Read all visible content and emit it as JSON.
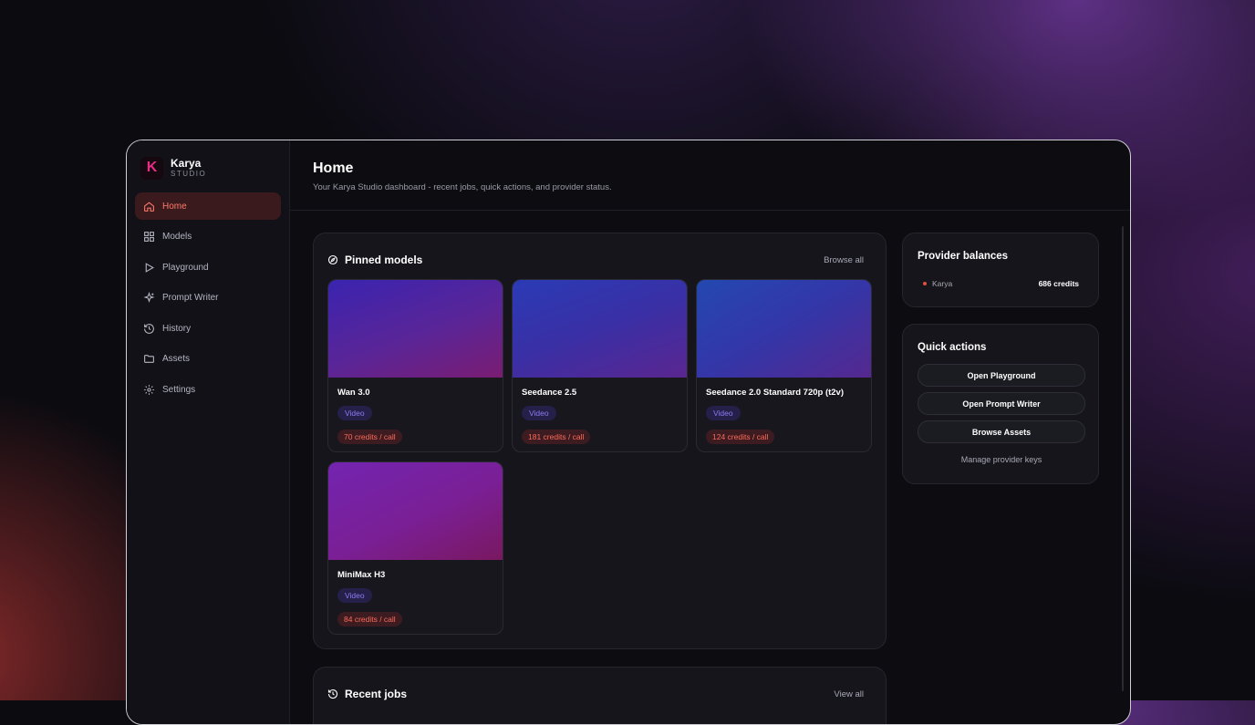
{
  "brand": {
    "name": "Karya",
    "sub": "STUDIO",
    "logo_letter": "K",
    "accent": "#ea2d86"
  },
  "nav": [
    {
      "label": "Home",
      "icon": "home-icon",
      "active": true
    },
    {
      "label": "Models",
      "icon": "grid-icon"
    },
    {
      "label": "Playground",
      "icon": "play-icon"
    },
    {
      "label": "Prompt Writer",
      "icon": "sparkle-icon"
    },
    {
      "label": "History",
      "icon": "history-icon"
    },
    {
      "label": "Assets",
      "icon": "folder-icon"
    },
    {
      "label": "Settings",
      "icon": "gear-icon"
    }
  ],
  "header": {
    "title": "Home",
    "subtitle": "Your Karya Studio dashboard - recent jobs, quick actions, and provider status."
  },
  "pinned": {
    "title": "Pinned models",
    "link": "Browse all",
    "models": [
      {
        "name": "Wan 3.0",
        "tag": "Video",
        "price": "70 credits / call"
      },
      {
        "name": "Seedance 2.5",
        "tag": "Video",
        "price": "181 credits / call"
      },
      {
        "name": "Seedance 2.0 Standard 720p (t2v)",
        "tag": "Video",
        "price": "124 credits / call"
      },
      {
        "name": "MiniMax H3",
        "tag": "Video",
        "price": "84 credits / call"
      }
    ]
  },
  "recent": {
    "title": "Recent jobs",
    "link": "View all"
  },
  "balances": {
    "title": "Provider balances",
    "rows": [
      {
        "provider": "Karya",
        "value": "686 credits"
      }
    ]
  },
  "quick": {
    "title": "Quick actions",
    "buttons": [
      "Open Playground",
      "Open Prompt Writer",
      "Browse Assets"
    ],
    "link": "Manage provider keys"
  }
}
